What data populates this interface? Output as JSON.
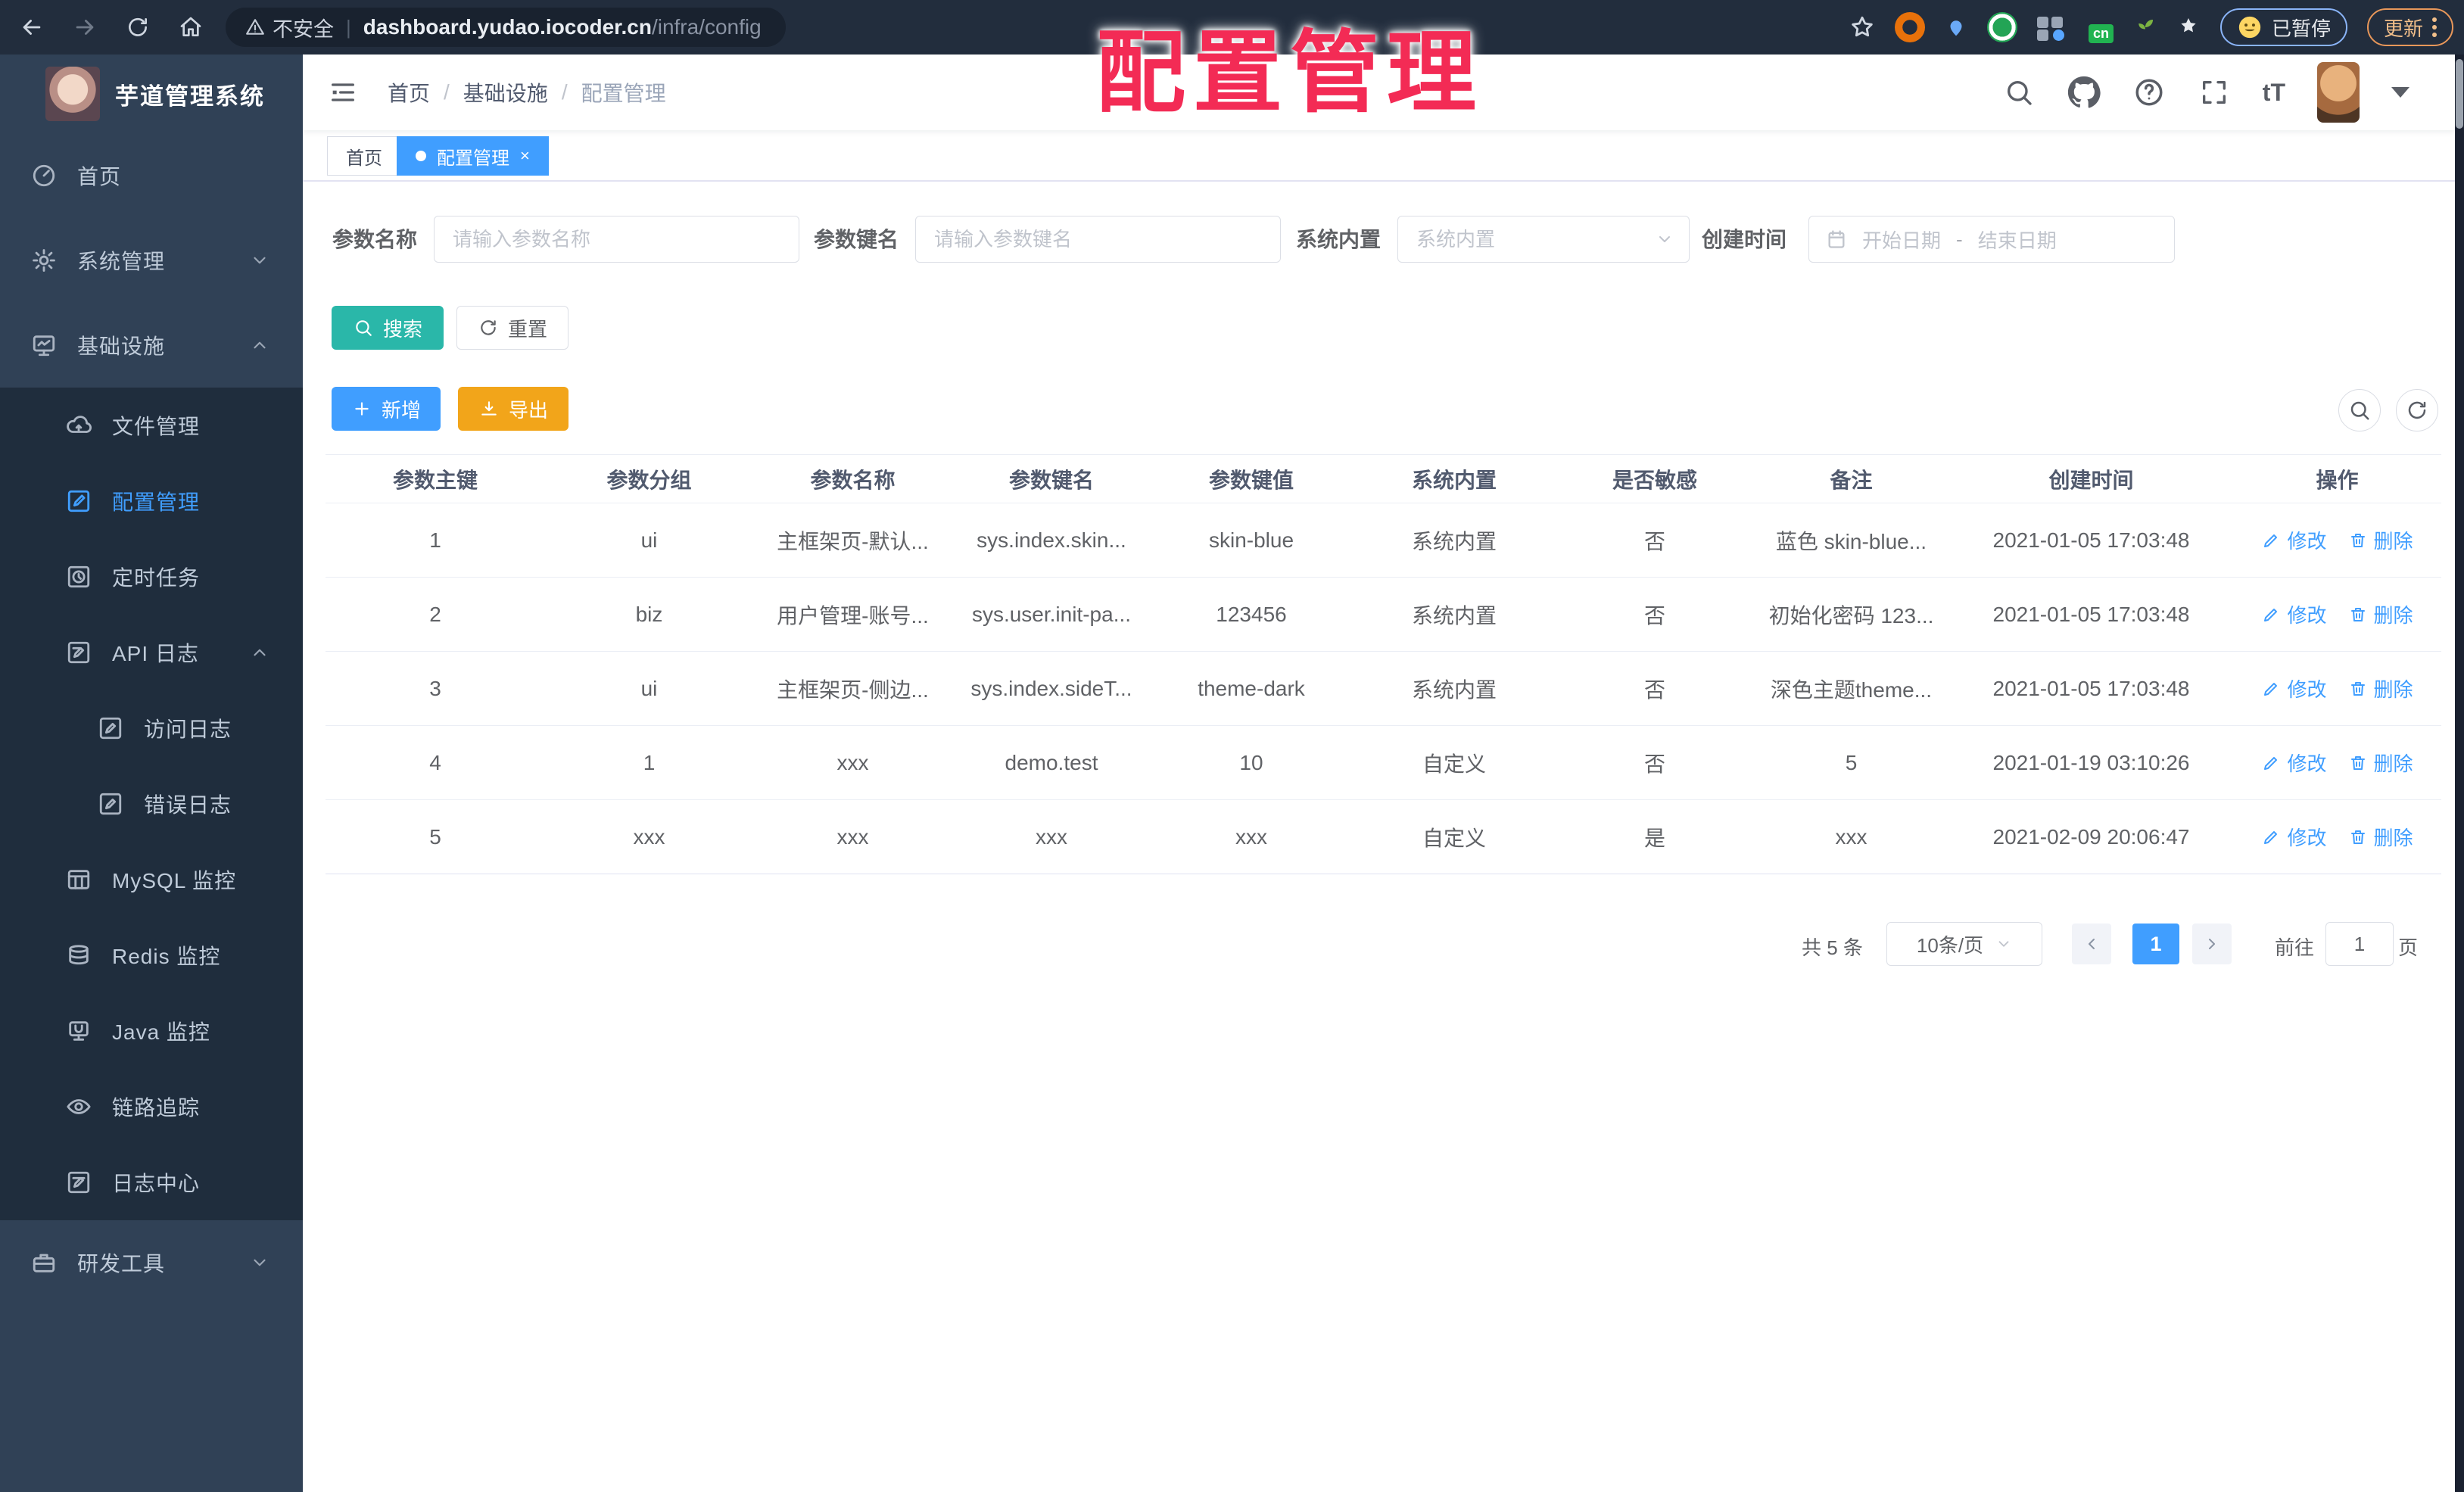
{
  "browser": {
    "security_label": "不安全",
    "url_host": "dashboard.yudao.iocoder.cn",
    "url_path": "/infra/config",
    "ext_badge": "cn",
    "paused_badge": "已暂停",
    "update_button": "更新"
  },
  "watermark": "配置管理",
  "colors": {
    "primary": "#409eff",
    "teal": "#2ab7a9",
    "warning": "#f2a51a",
    "watermark_red": "#f32b55",
    "sidebar_bg": "#304156",
    "submenu_bg": "#1f2d3d"
  },
  "sidebar": {
    "title": "芋道管理系统",
    "menu": [
      {
        "label": "首页",
        "icon": "dashboard-icon",
        "level": 0
      },
      {
        "label": "系统管理",
        "icon": "gear-icon",
        "level": 0,
        "chevron": "down"
      },
      {
        "label": "基础设施",
        "icon": "monitor-icon",
        "level": 0,
        "chevron": "up"
      },
      {
        "label": "文件管理",
        "icon": "cloud-icon",
        "level": 1
      },
      {
        "label": "配置管理",
        "icon": "edit-icon",
        "level": 1,
        "active": true
      },
      {
        "label": "定时任务",
        "icon": "timer-icon",
        "level": 1
      },
      {
        "label": "API 日志",
        "icon": "api-log-icon",
        "level": 1,
        "chevron": "up"
      },
      {
        "label": "访问日志",
        "icon": "access-log-icon",
        "level": 2
      },
      {
        "label": "错误日志",
        "icon": "error-log-icon",
        "level": 2
      },
      {
        "label": "MySQL 监控",
        "icon": "mysql-icon",
        "level": 1
      },
      {
        "label": "Redis 监控",
        "icon": "redis-icon",
        "level": 1
      },
      {
        "label": "Java 监控",
        "icon": "java-icon",
        "level": 1
      },
      {
        "label": "链路追踪",
        "icon": "eye-icon",
        "level": 1
      },
      {
        "label": "日志中心",
        "icon": "log-center-icon",
        "level": 1
      },
      {
        "label": "研发工具",
        "icon": "briefcase-icon",
        "level": 0,
        "chevron": "down"
      }
    ]
  },
  "header": {
    "breadcrumb": [
      "首页",
      "基础设施",
      "配置管理"
    ],
    "font_size_label": "tT"
  },
  "tabs": [
    {
      "label": "首页",
      "active": false
    },
    {
      "label": "配置管理",
      "active": true,
      "closable": true
    }
  ],
  "filters": {
    "name_label": "参数名称",
    "name_placeholder": "请输入参数名称",
    "key_label": "参数键名",
    "key_placeholder": "请输入参数键名",
    "type_label": "系统内置",
    "type_placeholder": "系统内置",
    "date_label": "创建时间",
    "date_start": "开始日期",
    "date_separator": "-",
    "date_end": "结束日期"
  },
  "actions": {
    "search": "搜索",
    "reset": "重置",
    "add": "新增",
    "export": "导出"
  },
  "table": {
    "columns": [
      "参数主键",
      "参数分组",
      "参数名称",
      "参数键名",
      "参数键值",
      "系统内置",
      "是否敏感",
      "备注",
      "创建时间",
      "操作"
    ],
    "ops": {
      "edit": "修改",
      "delete": "删除"
    },
    "rows": [
      [
        "1",
        "ui",
        "主框架页-默认...",
        "sys.index.skin...",
        "skin-blue",
        "系统内置",
        "否",
        "蓝色 skin-blue...",
        "2021-01-05 17:03:48"
      ],
      [
        "2",
        "biz",
        "用户管理-账号...",
        "sys.user.init-pa...",
        "123456",
        "系统内置",
        "否",
        "初始化密码 123...",
        "2021-01-05 17:03:48"
      ],
      [
        "3",
        "ui",
        "主框架页-侧边...",
        "sys.index.sideT...",
        "theme-dark",
        "系统内置",
        "否",
        "深色主题theme...",
        "2021-01-05 17:03:48"
      ],
      [
        "4",
        "1",
        "xxx",
        "demo.test",
        "10",
        "自定义",
        "否",
        "5",
        "2021-01-19 03:10:26"
      ],
      [
        "5",
        "xxx",
        "xxx",
        "xxx",
        "xxx",
        "自定义",
        "是",
        "xxx",
        "2021-02-09 20:06:47"
      ]
    ]
  },
  "pagination": {
    "total": "共 5 条",
    "page_size": "10条/页",
    "current_page": "1",
    "goto_label": "前往",
    "goto_value": "1",
    "page_unit": "页"
  }
}
